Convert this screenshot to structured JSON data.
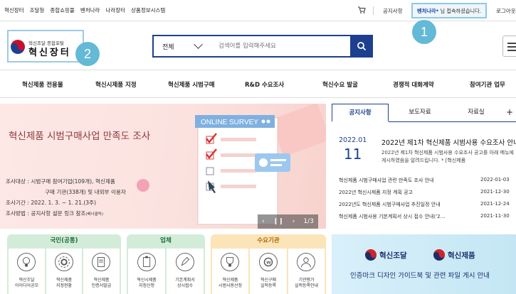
{
  "topbar": {
    "links": [
      "혁신장터",
      "조달청",
      "종합쇼핑몰",
      "벤처나라",
      "나라장터",
      "상품정보시스템"
    ],
    "notice": "공지사항",
    "welcome_user": "벤처나라*",
    "welcome_suffix": " 님 접속하셨습니다.",
    "logout": "로그아웃"
  },
  "logo": {
    "small": "혁신조달 종합포털",
    "big": "혁신장터"
  },
  "search": {
    "category": "전체",
    "placeholder": "검색어를 입력해주세요"
  },
  "nav": [
    "혁신제품 전용몰",
    "혁신시제품 지정",
    "혁신제품 시범구매",
    "R&D 수요조사",
    "혁신수요 발굴",
    "경쟁적 대화계약",
    "참여기관 업무"
  ],
  "banner": {
    "badge_text": "ONLINE SURVEY",
    "title": "혁신제품 시범구매사업 만족도 조사",
    "info": [
      "조사대상 : 시범구매 참여기업(109개), 혁신제품",
      "구매 기관(338개) 및 내외부 이용자",
      "조사기간 : 2022. 1. 3. ~ 1. 21.(3주)",
      "조사방법 : 공지사항 설문 링크 참조"
    ],
    "info_note": "(배너클릭)",
    "page": "1/3"
  },
  "news": {
    "tabs": [
      "공지사항",
      "보도자료",
      "자료실",
      "+"
    ],
    "featured": {
      "year_month": "2022.01",
      "day": "11",
      "title": "2022년 제1차 혁신제품 시범사용 수요조사 안내",
      "desc": "2022년 제1차 혁신제품 시범사용 수요조사 공고를 아래 메뉴에 게시하였음을 알려드립니다. * [혁신제품"
    },
    "items": [
      {
        "title": "혁신제품 시범구매사업 관련 만족도 조사 안내",
        "date": "2022-01-03"
      },
      {
        "title": "2022년 혁신시제품 지정 계획 공고",
        "date": "2021-12-30"
      },
      {
        "title": "2022년도 혁신제품 시범구매사업 추진일정 안내",
        "date": "2021-12-24"
      },
      {
        "title": "혁신제품 시범사용 기본계획서 상시 접수 안내('2…",
        "date": "2021-11-30"
      }
    ]
  },
  "quick": {
    "groups": [
      {
        "title": "국민(공통)",
        "items": [
          [
            "혁신조달",
            "아이디어공모"
          ],
          [
            "혁신제품",
            "지정현황"
          ],
          [
            "혁신제품",
            "인증서발급"
          ]
        ]
      },
      {
        "title": "업체",
        "items": [
          [
            "혁신시제품",
            "지정신청"
          ],
          [
            "기본계획서",
            "상시접수"
          ]
        ]
      },
      {
        "title": "수요기관",
        "items": [
          [
            "혁신제품",
            "시범사용선정"
          ],
          [
            "혁신구매",
            "실적등록"
          ],
          [
            "기관평가",
            "실적등록안내"
          ]
        ]
      }
    ],
    "colors": {
      "national": "#d3ecd9",
      "company": "#fbe4b8",
      "agency": "#fbe4b8"
    }
  },
  "promo": {
    "brand1": "혁신조달",
    "brand2": "혁신제품",
    "text": "인증마크 디자인 가이드북 및 관련 파일 게시 안내"
  },
  "annotations": [
    "1",
    "2"
  ],
  "colors": {
    "primary": "#1d3f8f",
    "annotation": "#63b9d6"
  }
}
